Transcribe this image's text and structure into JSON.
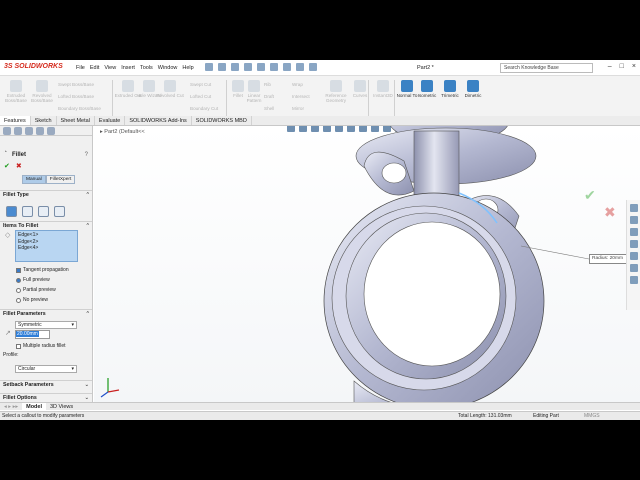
{
  "app": {
    "brand": "SOLIDWORKS",
    "document_title": "Part2 *"
  },
  "menu": [
    "File",
    "Edit",
    "View",
    "Insert",
    "Tools",
    "Window",
    "Help"
  ],
  "search": {
    "placeholder": "Search Knowledge Base"
  },
  "ribbon": {
    "buttons": [
      {
        "label": "Extruded Boss/Base",
        "active": false
      },
      {
        "label": "Revolved Boss/Base",
        "active": false
      },
      {
        "label": "Extruded Cut",
        "active": false
      },
      {
        "label": "Hole Wizard",
        "active": false
      },
      {
        "label": "Revolved Cut",
        "active": false
      },
      {
        "label": "Fillet",
        "active": false
      },
      {
        "label": "Linear Pattern",
        "active": false
      },
      {
        "label": "Reference Geometry",
        "active": false
      },
      {
        "label": "Curves",
        "active": false
      },
      {
        "label": "Instant3D",
        "active": false
      },
      {
        "label": "Normal To",
        "active": true
      },
      {
        "label": "Isometric",
        "active": true
      },
      {
        "label": "Trimetric",
        "active": true
      },
      {
        "label": "Dimetric",
        "active": true
      }
    ],
    "small": [
      "Swept Boss/Base",
      "Lofted Boss/Base",
      "Boundary Boss/Base",
      "Swept Cut",
      "Lofted Cut",
      "Boundary Cut",
      "Rib",
      "Draft",
      "Shell",
      "Wrap",
      "Intersect",
      "Mirror"
    ]
  },
  "tabs": [
    "Features",
    "Sketch",
    "Sheet Metal",
    "Evaluate",
    "SOLIDWORKS Add-Ins",
    "SOLIDWORKS MBD"
  ],
  "panel": {
    "title": "Fillet",
    "modes": [
      "Manual",
      "FilletXpert"
    ],
    "fillet_type_header": "Fillet Type",
    "items_header": "Items To Fillet",
    "edges": [
      "Edge<1>",
      "Edge<2>",
      "Edge<4>"
    ],
    "tangent_label": "Tangent propagation",
    "preview_options": [
      "Full preview",
      "Partial preview",
      "No preview"
    ],
    "params_header": "Fillet Parameters",
    "method_value": "Symmetric",
    "radius_value": "20.00mm",
    "multi_radius_label": "Multiple radius fillet",
    "profile_label": "Profile:",
    "profile_value": "Circular",
    "setback_header": "Setback Parameters",
    "options_header": "Fillet Options"
  },
  "viewport": {
    "tree_label": "Part2 (Default<<",
    "callout_label": "Radius:",
    "callout_value": "20mm"
  },
  "bottom_tabs": [
    "Model",
    "3D Views"
  ],
  "status": {
    "message": "Select a callout to modify parameters",
    "length": "Total Length: 131.03mm",
    "mode": "Editing Part",
    "units": "MMGS"
  }
}
